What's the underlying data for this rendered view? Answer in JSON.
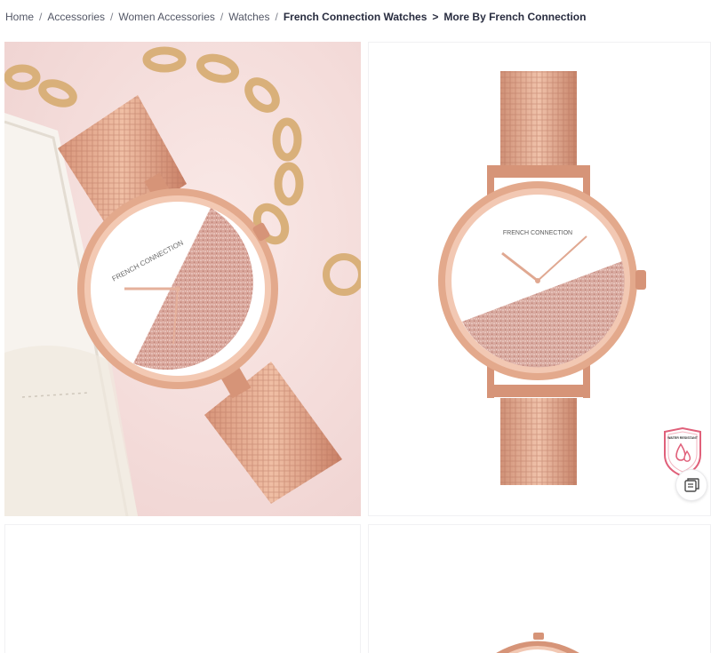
{
  "breadcrumb": {
    "items": [
      "Home",
      "Accessories",
      "Women Accessories",
      "Watches"
    ],
    "brand_watches": "French Connection Watches",
    "more_by": "More By French Connection"
  },
  "product_images": {
    "watch_brand_text": "FRENCH CONNECTION",
    "water_resistant_badge": "WATER RESISTANT",
    "colors": {
      "rose_gold": "#e3a98c",
      "rose_gold_dark": "#b8755a",
      "blush_background": "#f4dedd",
      "badge_pink": "#e0607a"
    }
  }
}
